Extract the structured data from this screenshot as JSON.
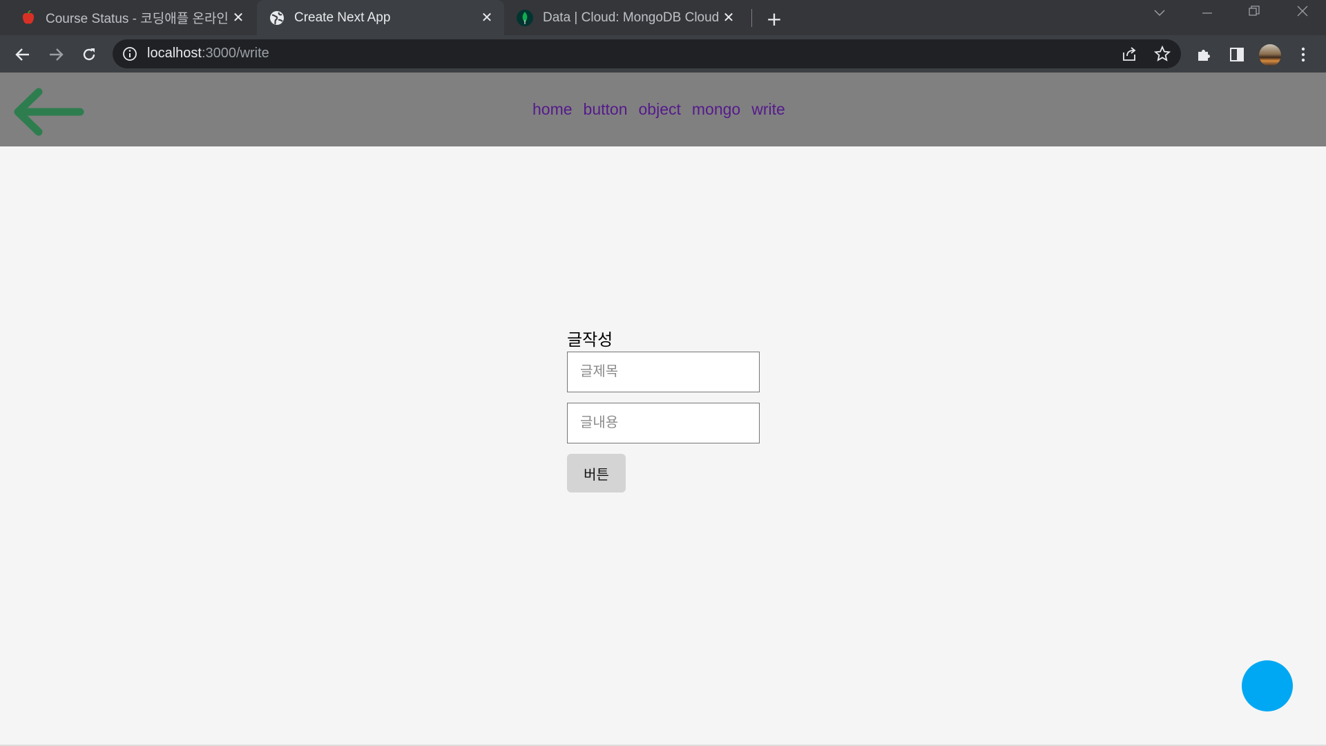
{
  "browser": {
    "tabs": [
      {
        "title": "Course Status - 코딩애플 온라인",
        "icon": "apple-icon",
        "active": false
      },
      {
        "title": "Create Next App",
        "icon": "globe-icon",
        "active": true
      },
      {
        "title": "Data | Cloud: MongoDB Cloud",
        "icon": "mongodb-leaf-icon",
        "active": false
      }
    ],
    "address": {
      "host": "localhost",
      "path": ":3000/write"
    }
  },
  "navbar": {
    "links": [
      "home",
      "button",
      "object",
      "mongo",
      "write"
    ],
    "back_icon": "arrow-left-icon",
    "back_color": "#2e7d4f",
    "link_color": "#551a8b",
    "background": "#808080"
  },
  "form": {
    "title": "글작성",
    "title_placeholder": "글제목",
    "content_placeholder": "글내용",
    "submit_label": "버튼"
  },
  "fab": {
    "color": "#00a8f3"
  }
}
